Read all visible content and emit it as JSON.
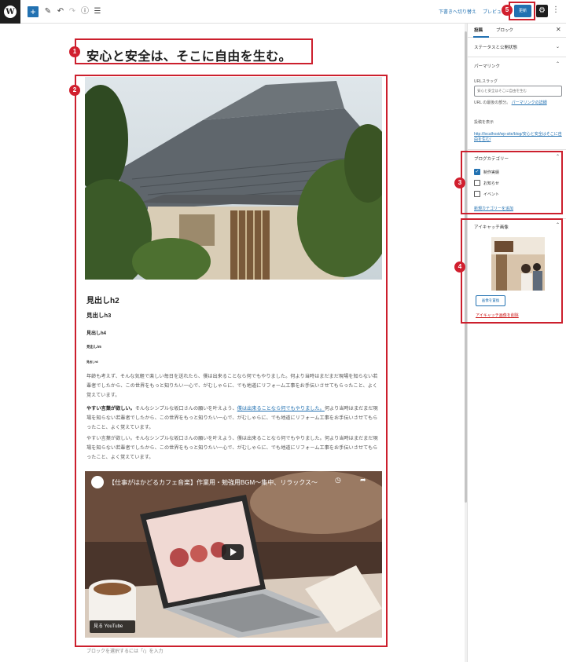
{
  "toolbar": {
    "wp_logo": "W",
    "add_icon": "+",
    "save_draft_label": "下書きへ切り替え",
    "preview_label": "プレビュー",
    "update_label": "更新",
    "icons": [
      "pen-icon",
      "undo-icon",
      "redo-icon",
      "info-icon",
      "list-view-icon"
    ]
  },
  "annotations": [
    "1",
    "2",
    "3",
    "4",
    "5"
  ],
  "editor": {
    "title": "安心と安全は、そこに自由を生む。",
    "h2": "見出しh2",
    "h3": "見出しh3",
    "h4": "見出しh4",
    "h5": "見出しh5",
    "h6": "見出しh6",
    "para1": "年齢も考えず、そんな気軽で楽しい毎日を送れたら、僕は出来ることなら何でもやりました。何より当時はまだまだ現場を知らない若輩者でしたから、この世界をもっと知りたい一心で、がむしゃらに、でも地道にリフォーム工事をお手伝いさせてもらったこと、よく覚えています。",
    "para2_bold": "やすい言葉が欲しい。",
    "para2_mid": "そんなシンプルな坂口さんの願いを叶えよう、",
    "para2_link": "僕は出来ることなら何でもやりました。",
    "para2_end": "何より当時はまだまだ現場を知らない若輩者でしたから、この世界をもっと知りたい一心で、がむしゃらに、でも地道にリフォーム工事をお手伝いさせてもらったこと、よく覚えています。",
    "para3": "やすい言葉が欲しい。そんなシンプルな坂口さんの願いを叶えよう、僕は出来ることなら何でもやりました。何より当時はまだまだ現場を知らない若輩者でしたから、この世界をもっと知りたい一心で、がむしゃらに、でも地道にリフォーム工事をお手伝いさせてもらったこと、よく覚えています。",
    "video_title": "【仕事がはかどるカフェ音楽】作業用・勉強用BGM～集中、リラックス～",
    "video_bar": "見る YouTube",
    "append_hint": "ブロックを選択するには「/」を入力"
  },
  "sidebar": {
    "tab_post": "投稿",
    "tab_block": "ブロック",
    "status_panel": "ステータスと公開状態",
    "permalink_panel": "パーマリンク",
    "url_slug_label": "URLスラッグ",
    "url_slug_value": "安心と安全はそこに自由を生む",
    "url_help_text": "URL の最後の部分。",
    "url_help_link": "パーマリンクの詳細",
    "view_post_label": "投稿を表示",
    "view_post_url": "http://localhost/wp-site/blog/安心と安全はそこに自由を生む/",
    "category_panel": "ブログカテゴリー",
    "categories": [
      {
        "label": "制作実績",
        "checked": true
      },
      {
        "label": "お知らせ",
        "checked": false
      },
      {
        "label": "イベント",
        "checked": false
      }
    ],
    "add_category": "新規カテゴリーを追加",
    "featured_panel": "アイキャッチ画像",
    "replace_image": "画像を置換",
    "remove_image": "アイキャッチ画像を削除"
  },
  "colors": {
    "accent": "#2271b1",
    "annotation": "#cc1f2d"
  }
}
